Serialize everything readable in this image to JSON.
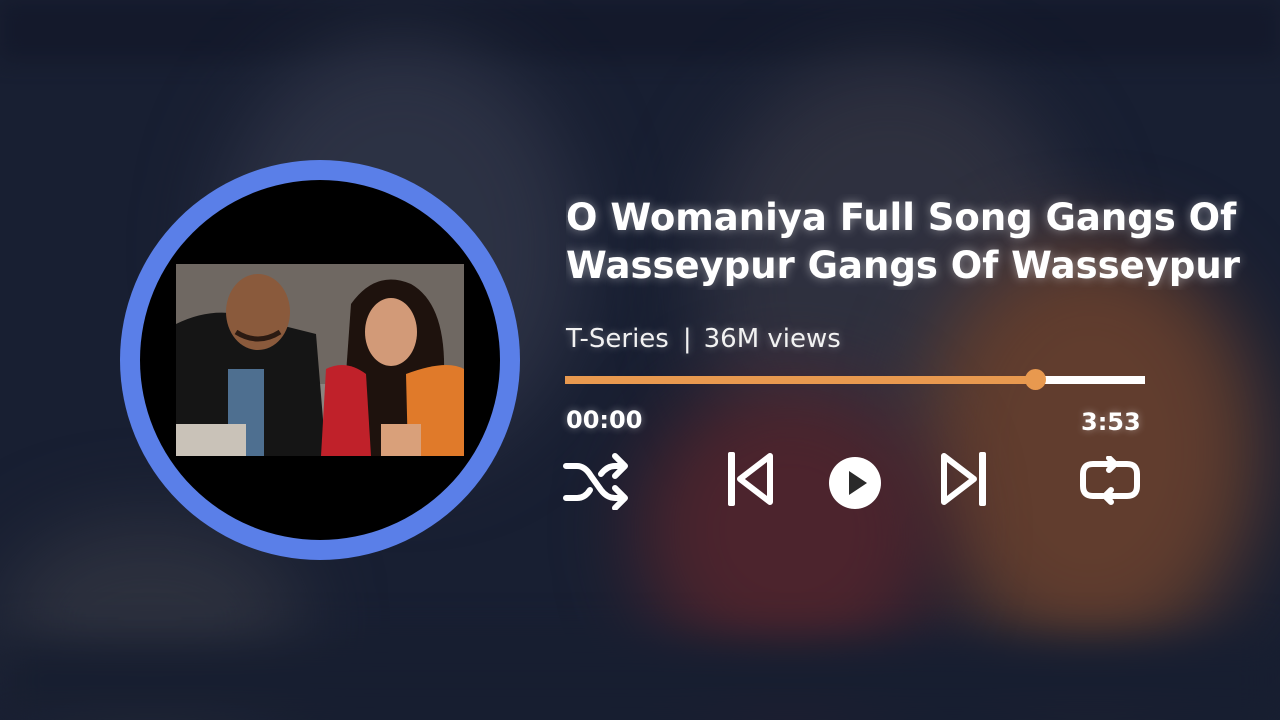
{
  "track": {
    "title_line1": "O Womaniya Full Song Gangs Of",
    "title_line2": "Wasseypur Gangs Of Wasseypur",
    "channel": "T-Series",
    "separator": "|",
    "views": "36M views"
  },
  "player": {
    "elapsed": "00:00",
    "duration": "3:53",
    "progress_fraction": 0.81
  },
  "controls": {
    "shuffle_icon": "shuffle-icon",
    "previous_icon": "skip-previous-icon",
    "play_icon": "play-icon",
    "next_icon": "skip-next-icon",
    "repeat_icon": "repeat-icon"
  },
  "colors": {
    "accent": "#e8994f",
    "ring": "#5a7fe8",
    "text": "#ffffff"
  }
}
